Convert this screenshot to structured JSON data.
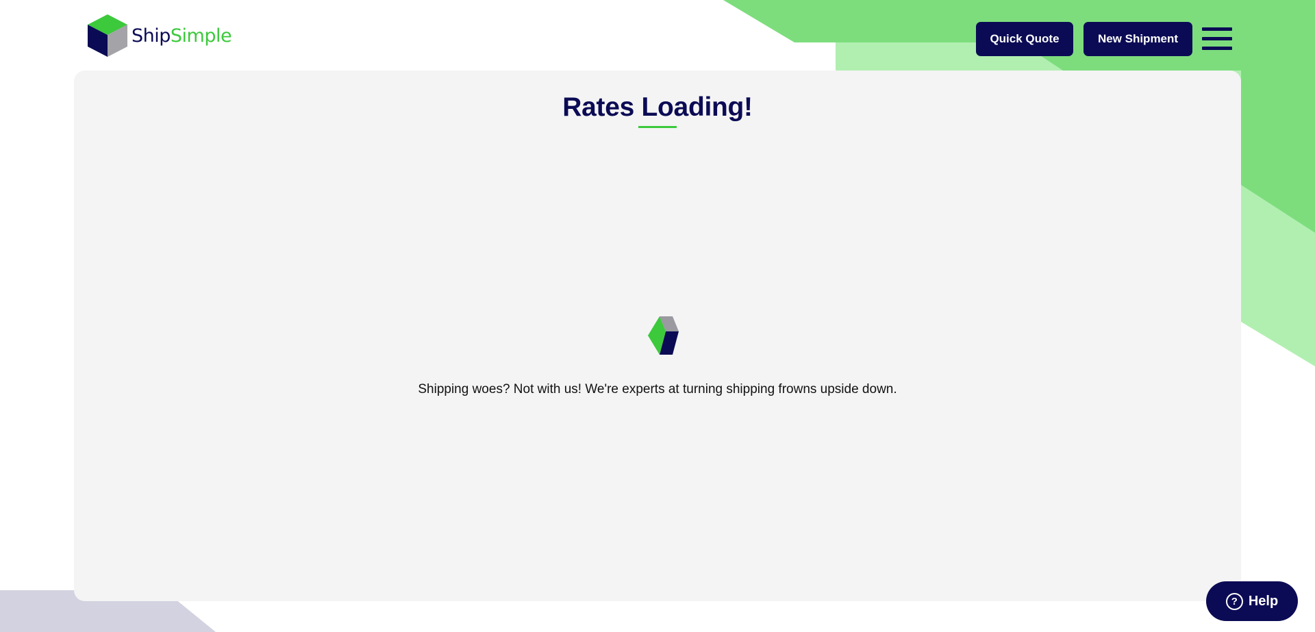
{
  "brand": {
    "name_part1": "Ship",
    "name_part2": "Simple",
    "primary_color": "#0b0b55",
    "accent_color": "#3cc93c",
    "light_accent_color": "#b1efb1",
    "mid_accent_color": "#7ddd7d",
    "card_background": "#f4f4f4",
    "footer_shape_color": "#d2d2e0"
  },
  "header": {
    "quick_quote_label": "Quick Quote",
    "new_shipment_label": "New Shipment",
    "menu_icon": "hamburger-menu-icon"
  },
  "main": {
    "title": "Rates Loading!",
    "message": "Shipping woes? Not with us! We're experts at turning shipping frowns upside down.",
    "loader_icon": "cube-loader-icon"
  },
  "help": {
    "label": "Help",
    "icon": "question-circle-icon",
    "icon_glyph": "?"
  }
}
